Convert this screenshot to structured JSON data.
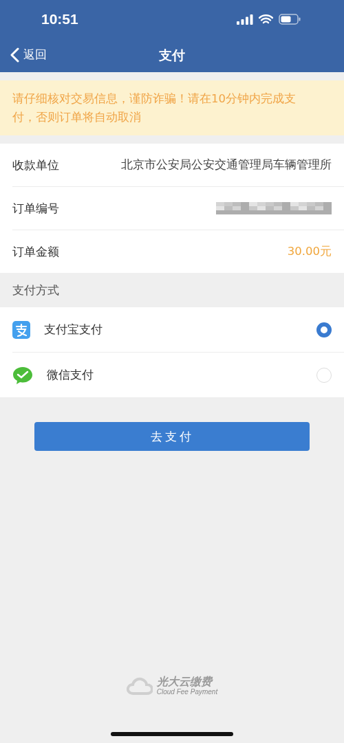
{
  "status_bar": {
    "time": "10:51"
  },
  "nav": {
    "back": "返回",
    "title": "支付"
  },
  "notice": "请仔细核对交易信息，谨防诈骗！请在10分钟内完成支付，否则订单将自动取消",
  "details": [
    {
      "kind": "text",
      "label": "收款单位",
      "value": "北京市公安局公安交通管理局车辆管理所"
    },
    {
      "kind": "redacted",
      "label": "订单编号"
    },
    {
      "kind": "amount",
      "label": "订单金额",
      "value": "30.00元"
    }
  ],
  "payment_section": {
    "title": "支付方式",
    "methods": [
      {
        "kind": "alipay",
        "label": "支付宝支付",
        "selected": true
      },
      {
        "kind": "wechat",
        "label": "微信支付",
        "selected": false
      }
    ]
  },
  "pay_button": "去支付",
  "footer": {
    "brand": "光大云缴费",
    "tagline": "Cloud Fee Payment"
  }
}
